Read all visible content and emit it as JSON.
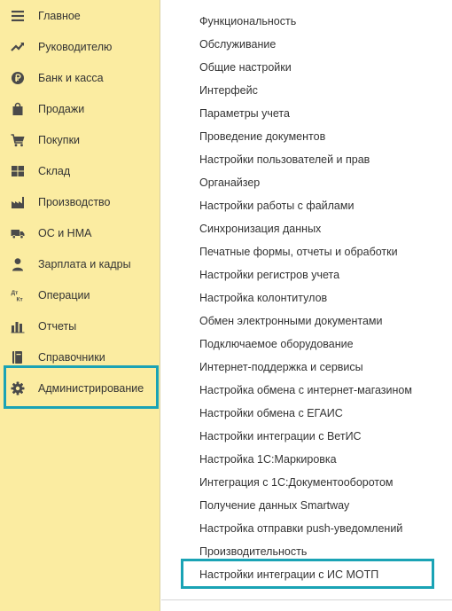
{
  "colors": {
    "sidebar_bg": "#fbeca1",
    "accent_frame": "#1aa3b5",
    "icon": "#4a4a4a",
    "text": "#333333"
  },
  "sidebar": {
    "items": [
      {
        "label": "Главное",
        "icon": "menu-lines-icon"
      },
      {
        "label": "Руководителю",
        "icon": "trend-up-icon"
      },
      {
        "label": "Банк и касса",
        "icon": "ruble-coin-icon"
      },
      {
        "label": "Продажи",
        "icon": "shopping-bag-icon"
      },
      {
        "label": "Покупки",
        "icon": "cart-icon"
      },
      {
        "label": "Склад",
        "icon": "warehouse-grid-icon"
      },
      {
        "label": "Производство",
        "icon": "factory-icon"
      },
      {
        "label": "ОС и НМА",
        "icon": "truck-icon"
      },
      {
        "label": "Зарплата и кадры",
        "icon": "person-icon"
      },
      {
        "label": "Операции",
        "icon": "debit-credit-icon"
      },
      {
        "label": "Отчеты",
        "icon": "bar-chart-icon"
      },
      {
        "label": "Справочники",
        "icon": "book-icon"
      },
      {
        "label": "Администрирование",
        "icon": "gear-icon",
        "active": true
      }
    ],
    "debit_credit_glyph": "Дт Кт"
  },
  "menu": {
    "items": [
      "Функциональность",
      "Обслуживание",
      "Общие настройки",
      "Интерфейс",
      "Параметры учета",
      "Проведение документов",
      "Настройки пользователей и прав",
      "Органайзер",
      "Настройки работы с файлами",
      "Синхронизация данных",
      "Печатные формы, отчеты и обработки",
      "Настройки регистров учета",
      "Настройка колонтитулов",
      "Обмен электронными документами",
      "Подключаемое оборудование",
      "Интернет-поддержка и сервисы",
      "Настройка обмена с интернет-магазином",
      "Настройки обмена с ЕГАИС",
      "Настройки интеграции с ВетИС",
      "Настройка 1С:Маркировка",
      "Интеграция с 1С:Документооборотом",
      "Получение данных Smartway",
      "Настройка отправки push-уведомлений",
      "Производительность",
      "Настройки интеграции с ИС МОТП"
    ],
    "highlighted_index": 24
  }
}
